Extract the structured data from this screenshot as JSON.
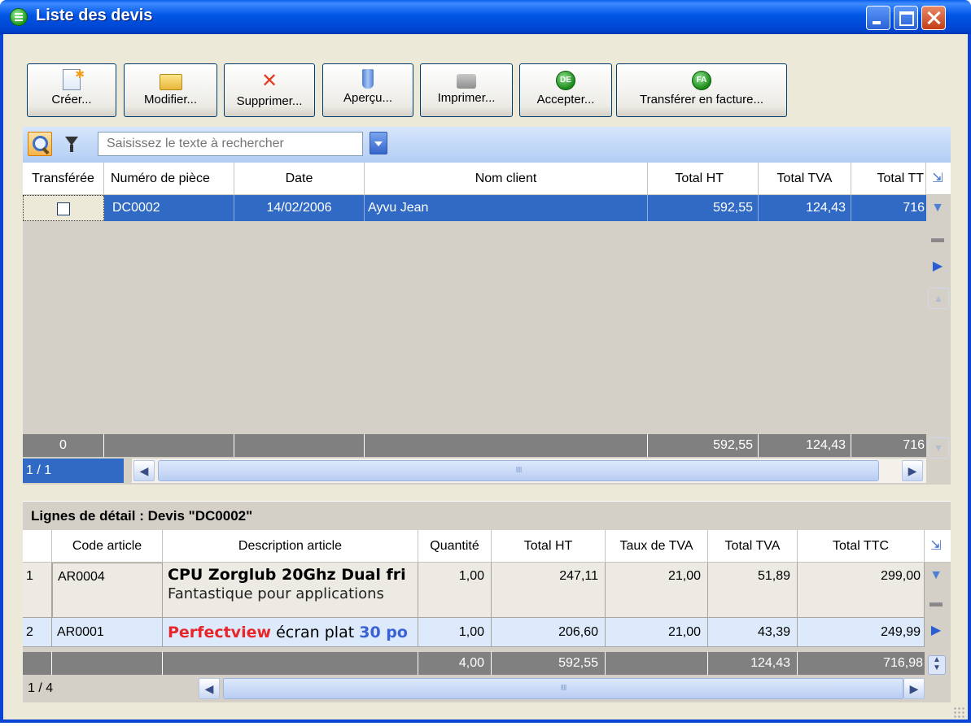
{
  "window": {
    "title": "Liste des devis"
  },
  "toolbar": {
    "create": "Créer...",
    "modify": "Modifier...",
    "delete": "Supprimer...",
    "preview": "Aperçu...",
    "print": "Imprimer...",
    "accept": "Accepter...",
    "transfer": "Transférer en facture..."
  },
  "icons": {
    "accept_badge": "DE",
    "transfer_badge": "FA"
  },
  "search": {
    "placeholder": "Saisissez le texte à rechercher"
  },
  "quotes": {
    "columns": [
      "Transférée",
      "Numéro de pièce",
      "Date",
      "Nom client",
      "Total HT",
      "Total TVA",
      "Total TT"
    ],
    "rows": [
      {
        "transferred": false,
        "number": "DC0002",
        "date": "14/02/2006",
        "client": "Ayvu Jean",
        "total_ht": "592,55",
        "total_tva": "124,43",
        "total_ttc": "716"
      }
    ],
    "footer": {
      "count": "0",
      "total_ht": "592,55",
      "total_tva": "124,43",
      "total_ttc": "716"
    },
    "pager": "1 / 1"
  },
  "detail": {
    "title": "Lignes de détail : Devis \"DC0002\"",
    "columns": [
      "Code article",
      "Description article",
      "Quantité",
      "Total HT",
      "Taux de TVA",
      "Total TVA",
      "Total TTC"
    ],
    "rows": [
      {
        "index": "1",
        "code": "AR0004",
        "desc_line1": "CPU Zorglub 20Ghz Dual fri",
        "desc_line2": "Fantastique pour applications",
        "qty": "1,00",
        "total_ht": "247,11",
        "tva_rate": "21,00",
        "total_tva": "51,89",
        "total_ttc": "299,00"
      },
      {
        "index": "2",
        "code": "AR0001",
        "desc_red": "Perfectview",
        "desc_plain": " écran plat ",
        "desc_blue": "30 po",
        "qty": "1,00",
        "total_ht": "206,60",
        "tva_rate": "21,00",
        "total_tva": "43,39",
        "total_ttc": "249,99"
      }
    ],
    "footer": {
      "qty": "4,00",
      "total_ht": "592,55",
      "total_tva": "124,43",
      "total_ttc": "716,98"
    },
    "pager": "1 / 4"
  }
}
